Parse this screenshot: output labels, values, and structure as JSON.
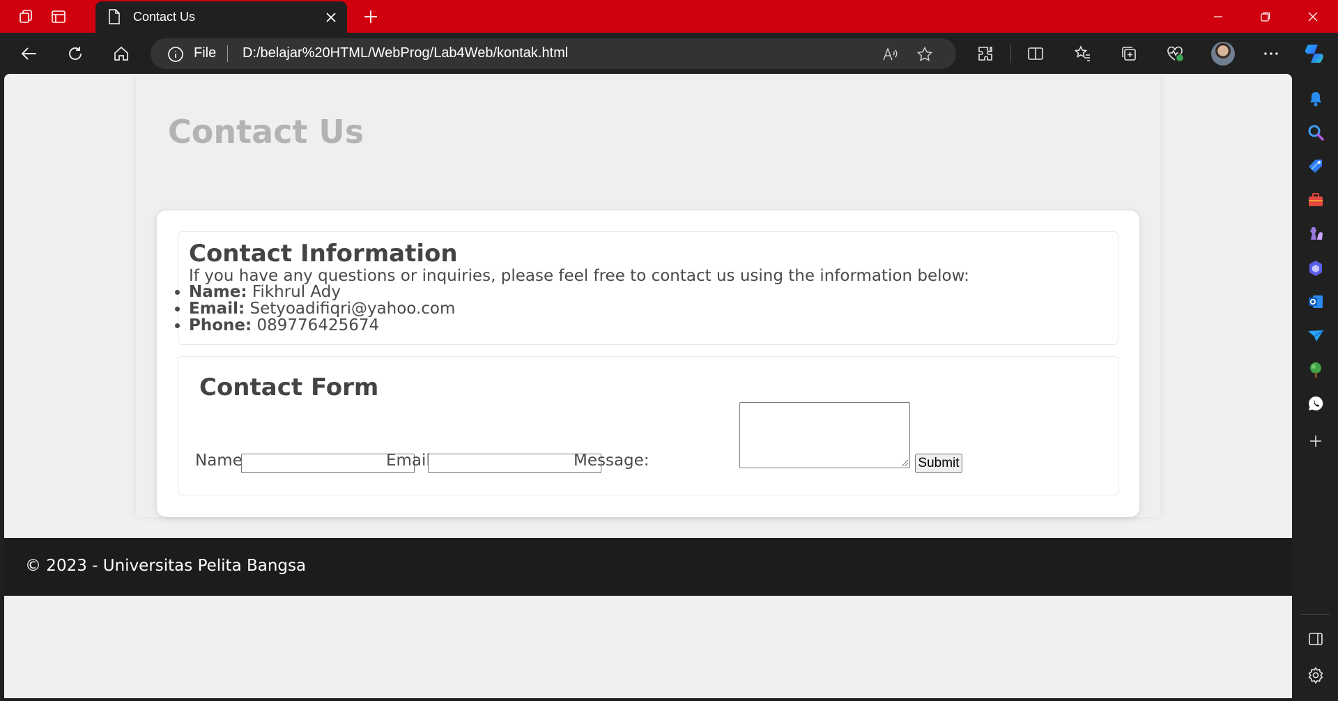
{
  "browser": {
    "tab_title": "Contact Us",
    "address_scheme_label": "File",
    "address_url": "D:/belajar%20HTML/WebProg/Lab4Web/kontak.html",
    "accent_color": "#d1000f"
  },
  "page": {
    "title": "Contact Us",
    "info": {
      "heading": "Contact Information",
      "intro": "If you have any questions or inquiries, please feel free to contact us using the information below:",
      "items": [
        {
          "label": "Name:",
          "value": "Fikhrul Ady"
        },
        {
          "label": "Email:",
          "value": "Setyoadifiqri@yahoo.com"
        },
        {
          "label": "Phone:",
          "value": "089776425674"
        }
      ]
    },
    "form": {
      "heading": "Contact Form",
      "name_label": "Name:",
      "name_value": "",
      "email_label": "Email:",
      "email_value": "",
      "message_label": "Message:",
      "message_value": "",
      "submit_label": "Submit"
    },
    "footer": "© 2023 - Universitas Pelita Bangsa"
  },
  "sidebar": {
    "items": [
      "copilot-icon",
      "bell-icon",
      "search-icon",
      "tag-icon",
      "toolbox-icon",
      "games-icon",
      "copilot-app-icon",
      "outlook-icon",
      "send-icon",
      "tree-icon",
      "whatsapp-icon",
      "add-icon"
    ],
    "bottom": [
      "sidebar-toggle-icon",
      "settings-icon"
    ]
  }
}
